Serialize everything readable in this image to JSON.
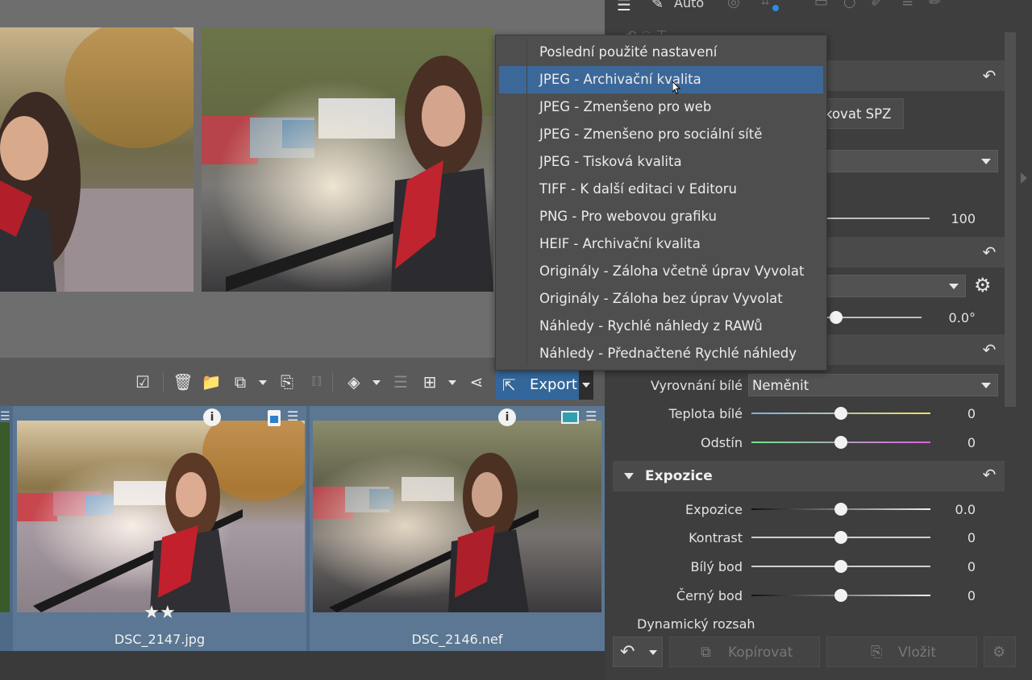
{
  "top_panel": {
    "auto_label": "Auto"
  },
  "filmstrip": {
    "files": [
      {
        "name": "DSC_2147.jpg",
        "rating": "★★"
      },
      {
        "name": "DSC_2146.nef",
        "rating": ""
      }
    ]
  },
  "toolbar": {
    "export_label": "Export"
  },
  "export_menu": {
    "items": [
      "Poslední použité nastavení",
      "JPEG - Archivační kvalita",
      "JPEG - Zmenšeno pro web",
      "JPEG - Zmenšeno pro sociální sítě",
      "JPEG - Tisková kvalita",
      "TIFF - K další editaci v Editoru",
      "PNG - Pro webovou grafiku",
      "HEIF - Archivační kvalita",
      "Originály - Záloha včetně úprav Vyvolat",
      "Originály - Záloha bez úprav Vyvolat",
      "Náhledy - Rychlé náhledy z RAWů",
      "Náhledy - Přednačtené Rychlé náhledy"
    ],
    "selected_index": 1
  },
  "panel": {
    "spz_button_partial": "kovat SPZ",
    "slider_value_1": "100",
    "rotation_value": "0.0°",
    "white_balance": {
      "label": "Vyrovnání bílé",
      "value": "Neměnit",
      "temperature": {
        "label": "Teplota bílé",
        "value": "0"
      },
      "tint": {
        "label": "Odstín",
        "value": "0"
      }
    },
    "exposure_section": {
      "title": "Expozice",
      "rows": [
        {
          "label": "Expozice",
          "value": "0.0"
        },
        {
          "label": "Kontrast",
          "value": "0"
        },
        {
          "label": "Bílý bod",
          "value": "0"
        },
        {
          "label": "Černý bod",
          "value": "0"
        }
      ],
      "dynamic_range_label": "Dynamický rozsah"
    },
    "bottom": {
      "copy_label": "Kopírovat",
      "paste_label": "Vložit"
    }
  },
  "colors": {
    "accent": "#33669a",
    "menu_selected": "#3c6899",
    "filmstrip_bg": "#4e6a87"
  }
}
